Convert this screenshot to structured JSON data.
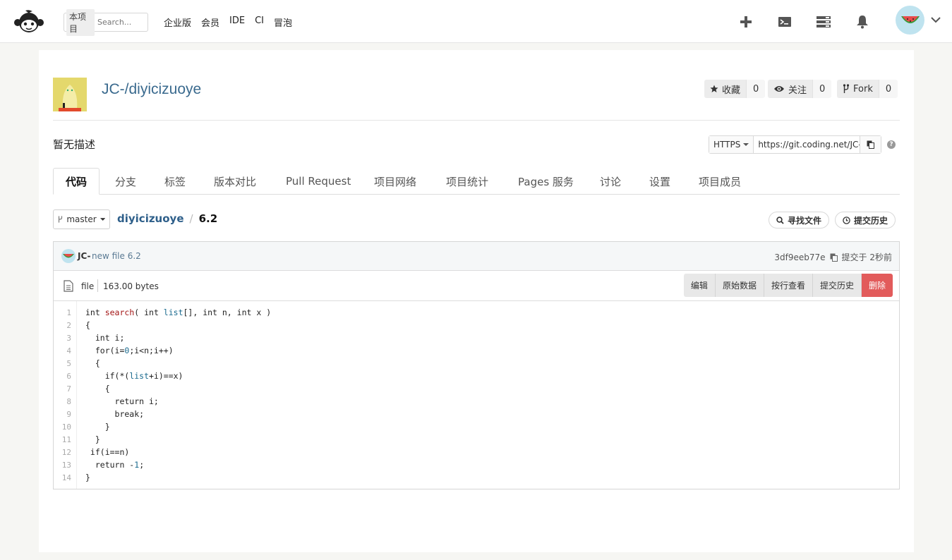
{
  "topbar": {
    "search_scope": "本项目",
    "search_placeholder": "Search...",
    "nav": [
      "企业版",
      "会员",
      "IDE",
      "CI",
      "冒泡"
    ]
  },
  "project": {
    "title": "JC-/diyicizuoye",
    "description": "暂无描述",
    "star_label": "收藏",
    "star_count": "0",
    "watch_label": "关注",
    "watch_count": "0",
    "fork_label": "Fork",
    "fork_count": "0"
  },
  "clone": {
    "protocol": "HTTPS",
    "url": "https://git.coding.net/JC-/diyicizuoye.git"
  },
  "tabs": [
    "代码",
    "分支",
    "标签",
    "版本对比",
    "Pull Request",
    "项目网络",
    "项目统计",
    "Pages 服务",
    "讨论",
    "设置",
    "项目成员"
  ],
  "branch": "master",
  "breadcrumb": {
    "repo": "diyicizuoye",
    "sep": "/",
    "file": "6.2"
  },
  "find_file": "寻找文件",
  "history": "提交历史",
  "commit": {
    "author": "JC-",
    "message": "new file 6.2",
    "hash": "3df9eeb77e",
    "time": "提交于 2秒前"
  },
  "file": {
    "type": "file",
    "size": "163.00 bytes",
    "actions": [
      "编辑",
      "原始数据",
      "按行查看",
      "提交历史",
      "删除"
    ]
  },
  "code_lines": [
    "int search( int list[], int n, int x )",
    "{",
    "  int i;",
    "  for(i=0;i<n;i++)",
    "  {",
    "    if(*(list+i)==x)",
    "    {",
    "      return i;",
    "      break;",
    "    }",
    "  }",
    " if(i==n)",
    "  return -1;",
    "}"
  ],
  "colors": {
    "link": "#2e5f8a",
    "danger": "#e25b5b",
    "card": "#ffffff",
    "bg": "#f6f6f3"
  }
}
